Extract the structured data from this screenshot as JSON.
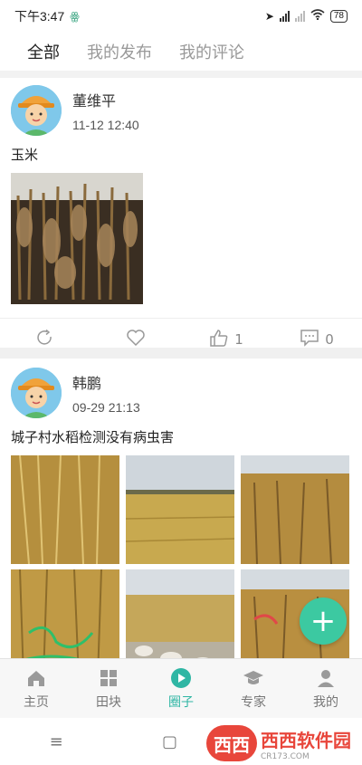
{
  "status_bar": {
    "time": "下午3:47",
    "battery": "78"
  },
  "tabs": [
    {
      "label": "全部",
      "active": true
    },
    {
      "label": "我的发布",
      "active": false
    },
    {
      "label": "我的评论",
      "active": false
    }
  ],
  "posts": [
    {
      "author": "董维平",
      "time": "11-12 12:40",
      "text": "玉米",
      "likes": "1",
      "comments": "0"
    },
    {
      "author": "韩鹏",
      "time": "09-29 21:13",
      "text": "城子村水稻检测没有病虫害"
    }
  ],
  "bottom_nav": [
    {
      "label": "主页",
      "icon": "home-icon"
    },
    {
      "label": "田块",
      "icon": "field-icon"
    },
    {
      "label": "圈子",
      "icon": "circle-play-icon",
      "active": true
    },
    {
      "label": "专家",
      "icon": "graduation-cap-icon"
    },
    {
      "label": "我的",
      "icon": "user-icon"
    }
  ],
  "watermark": {
    "brand": "西西软件园",
    "logo_text": "西西",
    "url": "CR173.COM"
  },
  "colors": {
    "accent": "#2fb6a4",
    "fab": "#3cc9a1",
    "crop_dry": "#6b5230",
    "rice": "#c8a94f"
  }
}
